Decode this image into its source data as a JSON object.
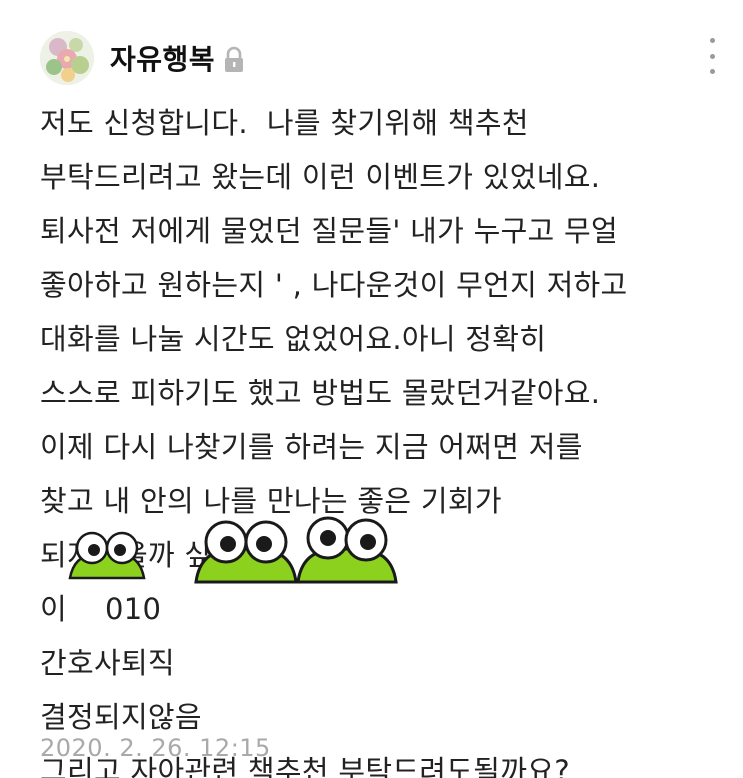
{
  "post": {
    "author": "자유행복",
    "body_lines": [
      "저도 신청합니다.  나를 찾기위해 책추천",
      "부탁드리려고 왔는데 이런 이벤트가 있었네요.",
      "퇴사전 저에게 물었던 질문들' 내가 누구고 무얼",
      "좋아하고 원하는지 ' , 나다운것이 무언지 저하고",
      "대화를 나눌 시간도 없었어요.아니 정확히",
      "스스로 피하기도 했고 방법도 몰랐던거같아요.",
      "이제 다시 나찾기를 하려는 지금 어쩌면 저를",
      "찾고 내 안의 나를 만나는 좋은 기회가",
      "되지않을까 싶어요.",
      "이    010",
      "간호사퇴직",
      "결정되지않음",
      "그리고 자아관련 책추천 부탁드려도될까요?"
    ],
    "date": "2020. 2. 26. 12:15"
  },
  "icons": {
    "avatar": "flower-avatar",
    "lock": "lock-icon",
    "more": "more-vertical-icon",
    "sticker": "frog-sticker"
  },
  "colors": {
    "text": "#222222",
    "date": "#a9a9a9",
    "lock": "#b5b5b5",
    "frog_green": "#8cd11e",
    "frog_outline": "#1a1a1a"
  }
}
